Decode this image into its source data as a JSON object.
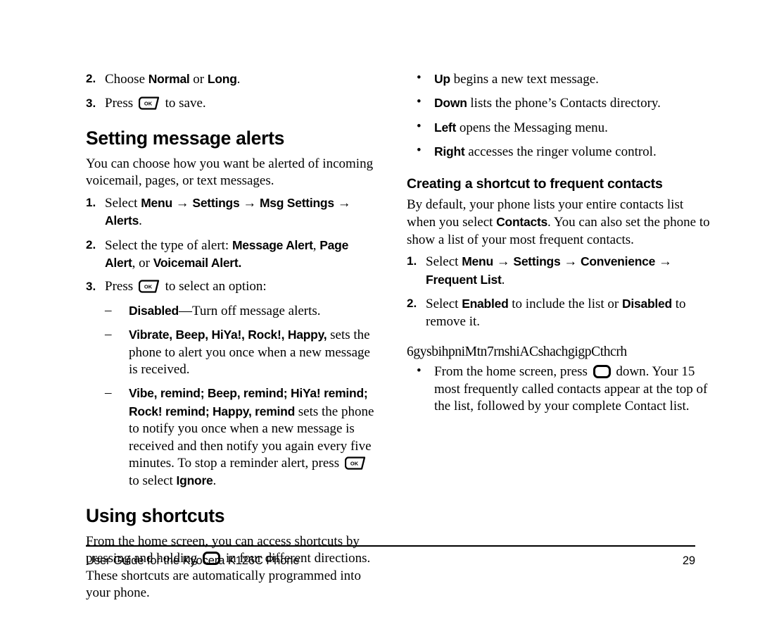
{
  "document": {
    "footer_text": "User Guide for the Kyocera K126C Phone",
    "page_number": "29"
  },
  "icons": {
    "ok_key_label": "OK",
    "ok_key_name": "ok-key-icon",
    "nav_key_name": "navigation-key-icon"
  },
  "left_column": {
    "continued_steps": [
      {
        "number": "2.",
        "parts": [
          {
            "text": "Choose ",
            "bold": false
          },
          {
            "text": "Normal",
            "bold": true
          },
          {
            "text": " or ",
            "bold": false
          },
          {
            "text": "Long",
            "bold": true
          },
          {
            "text": ".",
            "bold": false
          }
        ]
      },
      {
        "number": "3.",
        "parts": [
          {
            "text": "Press ",
            "bold": false
          },
          {
            "icon": "ok-key"
          },
          {
            "text": " to save.",
            "bold": false
          }
        ]
      }
    ],
    "section_alerts": {
      "title": "Setting message alerts",
      "intro": "You can choose how you want be alerted of incoming voicemail, pages, or text messages.",
      "steps": [
        {
          "number": "1.",
          "parts": [
            {
              "text": "Select ",
              "bold": false
            },
            {
              "text": "Menu",
              "bold": true
            },
            {
              "text": " → ",
              "bold": false,
              "arrow": true
            },
            {
              "text": "Settings",
              "bold": true
            },
            {
              "text": " → ",
              "bold": false,
              "arrow": true
            },
            {
              "text": "Msg Settings",
              "bold": true
            },
            {
              "text": " → ",
              "bold": false,
              "arrow": true
            },
            {
              "text": "Alerts",
              "bold": true
            },
            {
              "text": ".",
              "bold": false
            }
          ]
        },
        {
          "number": "2.",
          "parts": [
            {
              "text": "Select the type of alert: ",
              "bold": false
            },
            {
              "text": "Message Alert",
              "bold": true
            },
            {
              "text": ", ",
              "bold": false
            },
            {
              "text": "Page Alert",
              "bold": true
            },
            {
              "text": ", or ",
              "bold": false
            },
            {
              "text": "Voicemail Alert.",
              "bold": true
            }
          ]
        },
        {
          "number": "3.",
          "parts": [
            {
              "text": "Press ",
              "bold": false
            },
            {
              "icon": "ok-key"
            },
            {
              "text": " to select an option:",
              "bold": false
            }
          ]
        }
      ],
      "options": [
        {
          "marker": "–",
          "parts": [
            {
              "text": "Disabled",
              "bold": true
            },
            {
              "text": "—Turn off message alerts.",
              "bold": false
            }
          ]
        },
        {
          "marker": "–",
          "parts": [
            {
              "text": "Vibrate, Beep, HiYa!, Rock!, Happy,",
              "bold": true
            },
            {
              "text": " sets the phone to alert you once when a new message is received.",
              "bold": false
            }
          ]
        },
        {
          "marker": "–",
          "parts": [
            {
              "text": "Vibe, remind; Beep, remind; HiYa! remind; Rock! remind; Happy, remind",
              "bold": true
            },
            {
              "text": " sets the phone to notify you once when a new message is received and then notify you again every five minutes. To stop a reminder alert, press ",
              "bold": false
            },
            {
              "icon": "ok-key"
            },
            {
              "text": " to select ",
              "bold": false
            },
            {
              "text": "Ignore",
              "bold": true
            },
            {
              "text": ".",
              "bold": false
            }
          ]
        }
      ]
    },
    "section_shortcuts": {
      "title": "Using shortcuts",
      "paragraph_parts": [
        {
          "text": "From the home screen, you can access shortcuts by pressing and holding ",
          "bold": false
        },
        {
          "icon": "nav-key"
        },
        {
          "text": " in four different directions. These shortcuts are automatically programmed into your phone.",
          "bold": false
        }
      ]
    }
  },
  "right_column": {
    "direction_bullets": [
      {
        "marker": "•",
        "parts": [
          {
            "text": "Up",
            "bold": true
          },
          {
            "text": " begins a new text message.",
            "bold": false
          }
        ]
      },
      {
        "marker": "•",
        "parts": [
          {
            "text": "Down",
            "bold": true
          },
          {
            "text": " lists the phone’s Contacts directory.",
            "bold": false
          }
        ]
      },
      {
        "marker": "•",
        "parts": [
          {
            "text": "Left",
            "bold": true
          },
          {
            "text": " opens the Messaging menu.",
            "bold": false
          }
        ]
      },
      {
        "marker": "•",
        "parts": [
          {
            "text": "Right",
            "bold": true
          },
          {
            "text": " accesses the ringer volume control.",
            "bold": false
          }
        ]
      }
    ],
    "section_frequent": {
      "title": "Creating a shortcut to frequent contacts",
      "paragraph_parts": [
        {
          "text": "By default, your phone lists your entire contacts list when you select ",
          "bold": false
        },
        {
          "text": "Contacts",
          "bold": true
        },
        {
          "text": ". You can also set the phone to show a list of your most frequent contacts.",
          "bold": false
        }
      ],
      "steps": [
        {
          "number": "1.",
          "parts": [
            {
              "text": "Select ",
              "bold": false
            },
            {
              "text": "Menu",
              "bold": true
            },
            {
              "text": " → ",
              "bold": false,
              "arrow": true
            },
            {
              "text": "Settings",
              "bold": true
            },
            {
              "text": " → ",
              "bold": false,
              "arrow": true
            },
            {
              "text": "Convenience",
              "bold": true
            },
            {
              "text": " → ",
              "bold": false,
              "arrow": true
            },
            {
              "text": "Frequent List",
              "bold": true
            },
            {
              "text": ".",
              "bold": false
            }
          ]
        },
        {
          "number": "2.",
          "parts": [
            {
              "text": "Select ",
              "bold": false
            },
            {
              "text": "Enabled",
              "bold": true
            },
            {
              "text": " to include the list or ",
              "bold": false
            },
            {
              "text": "Disabled",
              "bold": true
            },
            {
              "text": " to remove it.",
              "bold": false
            }
          ]
        }
      ]
    },
    "garbled_heading": "6gysbihpniMtn7rnshiACshachgigpCthcrh",
    "frequent_bullets": [
      {
        "marker": "•",
        "parts": [
          {
            "text": "From the home screen, press ",
            "bold": false
          },
          {
            "icon": "nav-key"
          },
          {
            "text": " down. Your 15 most frequently called contacts appear at the top of the list, followed by your complete Contact list.",
            "bold": false
          }
        ]
      }
    ]
  }
}
